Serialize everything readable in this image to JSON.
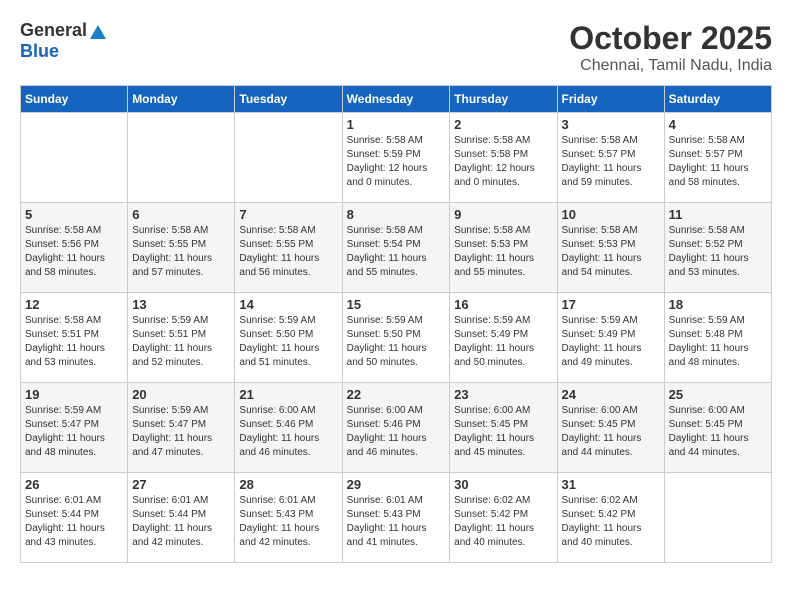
{
  "header": {
    "logo_general": "General",
    "logo_blue": "Blue",
    "month_year": "October 2025",
    "location": "Chennai, Tamil Nadu, India"
  },
  "weekdays": [
    "Sunday",
    "Monday",
    "Tuesday",
    "Wednesday",
    "Thursday",
    "Friday",
    "Saturday"
  ],
  "weeks": [
    [
      {
        "day": "",
        "info": ""
      },
      {
        "day": "",
        "info": ""
      },
      {
        "day": "",
        "info": ""
      },
      {
        "day": "1",
        "info": "Sunrise: 5:58 AM\nSunset: 5:59 PM\nDaylight: 12 hours\nand 0 minutes."
      },
      {
        "day": "2",
        "info": "Sunrise: 5:58 AM\nSunset: 5:58 PM\nDaylight: 12 hours\nand 0 minutes."
      },
      {
        "day": "3",
        "info": "Sunrise: 5:58 AM\nSunset: 5:57 PM\nDaylight: 11 hours\nand 59 minutes."
      },
      {
        "day": "4",
        "info": "Sunrise: 5:58 AM\nSunset: 5:57 PM\nDaylight: 11 hours\nand 58 minutes."
      }
    ],
    [
      {
        "day": "5",
        "info": "Sunrise: 5:58 AM\nSunset: 5:56 PM\nDaylight: 11 hours\nand 58 minutes."
      },
      {
        "day": "6",
        "info": "Sunrise: 5:58 AM\nSunset: 5:55 PM\nDaylight: 11 hours\nand 57 minutes."
      },
      {
        "day": "7",
        "info": "Sunrise: 5:58 AM\nSunset: 5:55 PM\nDaylight: 11 hours\nand 56 minutes."
      },
      {
        "day": "8",
        "info": "Sunrise: 5:58 AM\nSunset: 5:54 PM\nDaylight: 11 hours\nand 55 minutes."
      },
      {
        "day": "9",
        "info": "Sunrise: 5:58 AM\nSunset: 5:53 PM\nDaylight: 11 hours\nand 55 minutes."
      },
      {
        "day": "10",
        "info": "Sunrise: 5:58 AM\nSunset: 5:53 PM\nDaylight: 11 hours\nand 54 minutes."
      },
      {
        "day": "11",
        "info": "Sunrise: 5:58 AM\nSunset: 5:52 PM\nDaylight: 11 hours\nand 53 minutes."
      }
    ],
    [
      {
        "day": "12",
        "info": "Sunrise: 5:58 AM\nSunset: 5:51 PM\nDaylight: 11 hours\nand 53 minutes."
      },
      {
        "day": "13",
        "info": "Sunrise: 5:59 AM\nSunset: 5:51 PM\nDaylight: 11 hours\nand 52 minutes."
      },
      {
        "day": "14",
        "info": "Sunrise: 5:59 AM\nSunset: 5:50 PM\nDaylight: 11 hours\nand 51 minutes."
      },
      {
        "day": "15",
        "info": "Sunrise: 5:59 AM\nSunset: 5:50 PM\nDaylight: 11 hours\nand 50 minutes."
      },
      {
        "day": "16",
        "info": "Sunrise: 5:59 AM\nSunset: 5:49 PM\nDaylight: 11 hours\nand 50 minutes."
      },
      {
        "day": "17",
        "info": "Sunrise: 5:59 AM\nSunset: 5:49 PM\nDaylight: 11 hours\nand 49 minutes."
      },
      {
        "day": "18",
        "info": "Sunrise: 5:59 AM\nSunset: 5:48 PM\nDaylight: 11 hours\nand 48 minutes."
      }
    ],
    [
      {
        "day": "19",
        "info": "Sunrise: 5:59 AM\nSunset: 5:47 PM\nDaylight: 11 hours\nand 48 minutes."
      },
      {
        "day": "20",
        "info": "Sunrise: 5:59 AM\nSunset: 5:47 PM\nDaylight: 11 hours\nand 47 minutes."
      },
      {
        "day": "21",
        "info": "Sunrise: 6:00 AM\nSunset: 5:46 PM\nDaylight: 11 hours\nand 46 minutes."
      },
      {
        "day": "22",
        "info": "Sunrise: 6:00 AM\nSunset: 5:46 PM\nDaylight: 11 hours\nand 46 minutes."
      },
      {
        "day": "23",
        "info": "Sunrise: 6:00 AM\nSunset: 5:45 PM\nDaylight: 11 hours\nand 45 minutes."
      },
      {
        "day": "24",
        "info": "Sunrise: 6:00 AM\nSunset: 5:45 PM\nDaylight: 11 hours\nand 44 minutes."
      },
      {
        "day": "25",
        "info": "Sunrise: 6:00 AM\nSunset: 5:45 PM\nDaylight: 11 hours\nand 44 minutes."
      }
    ],
    [
      {
        "day": "26",
        "info": "Sunrise: 6:01 AM\nSunset: 5:44 PM\nDaylight: 11 hours\nand 43 minutes."
      },
      {
        "day": "27",
        "info": "Sunrise: 6:01 AM\nSunset: 5:44 PM\nDaylight: 11 hours\nand 42 minutes."
      },
      {
        "day": "28",
        "info": "Sunrise: 6:01 AM\nSunset: 5:43 PM\nDaylight: 11 hours\nand 42 minutes."
      },
      {
        "day": "29",
        "info": "Sunrise: 6:01 AM\nSunset: 5:43 PM\nDaylight: 11 hours\nand 41 minutes."
      },
      {
        "day": "30",
        "info": "Sunrise: 6:02 AM\nSunset: 5:42 PM\nDaylight: 11 hours\nand 40 minutes."
      },
      {
        "day": "31",
        "info": "Sunrise: 6:02 AM\nSunset: 5:42 PM\nDaylight: 11 hours\nand 40 minutes."
      },
      {
        "day": "",
        "info": ""
      }
    ]
  ]
}
